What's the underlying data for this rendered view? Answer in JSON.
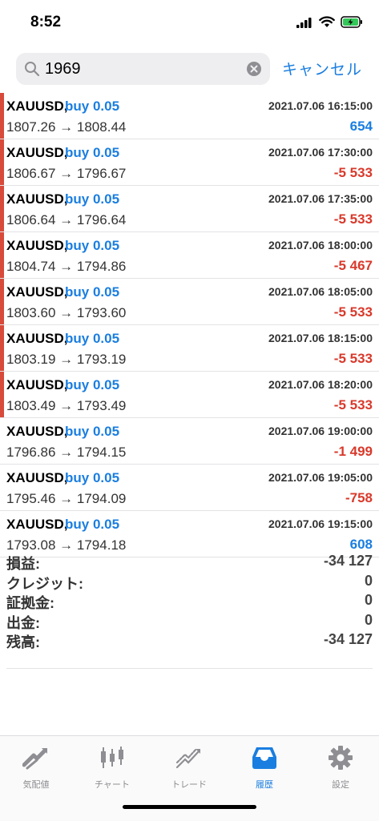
{
  "status_bar": {
    "time": "8:52"
  },
  "search": {
    "value": "1969",
    "cancel_label": "キャンセル"
  },
  "deals": [
    {
      "symbol": "XAUUSD,",
      "side": "buy 0.05",
      "datetime": "2021.07.06 16:15:00",
      "prices": "1807.26 → 1808.44",
      "profit": "654",
      "positive": true,
      "marked": true
    },
    {
      "symbol": "XAUUSD,",
      "side": "buy 0.05",
      "datetime": "2021.07.06 17:30:00",
      "prices": "1806.67 → 1796.67",
      "profit": "-5 533",
      "positive": false,
      "marked": true
    },
    {
      "symbol": "XAUUSD,",
      "side": "buy 0.05",
      "datetime": "2021.07.06 17:35:00",
      "prices": "1806.64 → 1796.64",
      "profit": "-5 533",
      "positive": false,
      "marked": true
    },
    {
      "symbol": "XAUUSD,",
      "side": "buy 0.05",
      "datetime": "2021.07.06 18:00:00",
      "prices": "1804.74 → 1794.86",
      "profit": "-5 467",
      "positive": false,
      "marked": true
    },
    {
      "symbol": "XAUUSD,",
      "side": "buy 0.05",
      "datetime": "2021.07.06 18:05:00",
      "prices": "1803.60 → 1793.60",
      "profit": "-5 533",
      "positive": false,
      "marked": true
    },
    {
      "symbol": "XAUUSD,",
      "side": "buy 0.05",
      "datetime": "2021.07.06 18:15:00",
      "prices": "1803.19 → 1793.19",
      "profit": "-5 533",
      "positive": false,
      "marked": true
    },
    {
      "symbol": "XAUUSD,",
      "side": "buy 0.05",
      "datetime": "2021.07.06 18:20:00",
      "prices": "1803.49 → 1793.49",
      "profit": "-5 533",
      "positive": false,
      "marked": true
    },
    {
      "symbol": "XAUUSD,",
      "side": "buy 0.05",
      "datetime": "2021.07.06 19:00:00",
      "prices": "1796.86 → 1794.15",
      "profit": "-1 499",
      "positive": false,
      "marked": false
    },
    {
      "symbol": "XAUUSD,",
      "side": "buy 0.05",
      "datetime": "2021.07.06 19:05:00",
      "prices": "1795.46 → 1794.09",
      "profit": "-758",
      "positive": false,
      "marked": false
    },
    {
      "symbol": "XAUUSD,",
      "side": "buy 0.05",
      "datetime": "2021.07.06 19:15:00",
      "prices": "1793.08 → 1794.18",
      "profit": "608",
      "positive": true,
      "marked": false
    }
  ],
  "summary": [
    {
      "label": "損益:",
      "value": "-34 127"
    },
    {
      "label": "クレジット:",
      "value": "0"
    },
    {
      "label": "証拠金:",
      "value": "0"
    },
    {
      "label": "出金:",
      "value": "0"
    },
    {
      "label": "残高:",
      "value": "-34 127"
    }
  ],
  "tabs": [
    {
      "label": "気配値",
      "icon": "quotes-icon",
      "active": false
    },
    {
      "label": "チャート",
      "icon": "candlestick-icon",
      "active": false
    },
    {
      "label": "トレード",
      "icon": "trade-icon",
      "active": false
    },
    {
      "label": "履歴",
      "icon": "history-tray-icon",
      "active": true
    },
    {
      "label": "設定",
      "icon": "gear-icon",
      "active": false
    }
  ],
  "colors": {
    "accent": "#1a7ee0",
    "loss": "#d8392b",
    "marker": "#d84a3a",
    "tab_inactive": "#8e8e93"
  }
}
